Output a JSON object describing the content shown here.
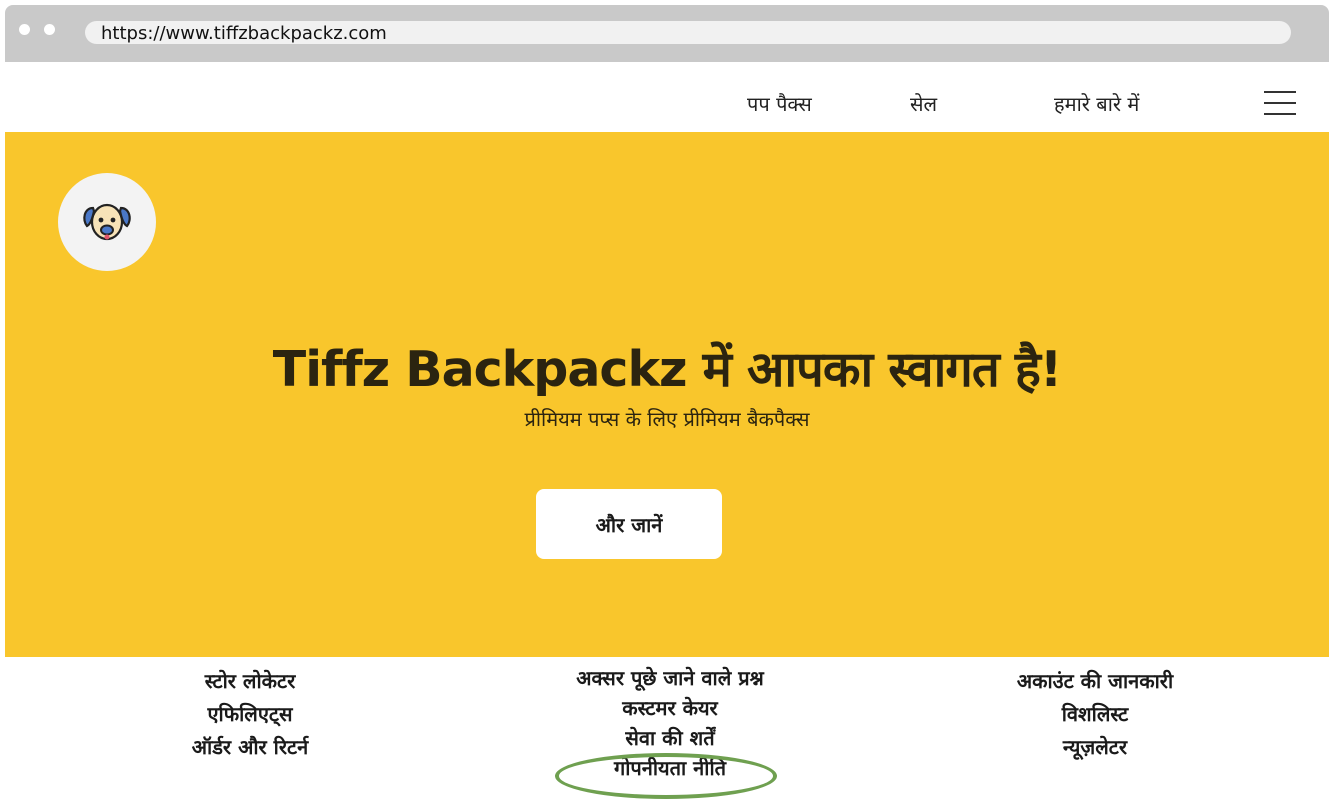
{
  "browser": {
    "url": "https://www.tiffzbackpackz.com"
  },
  "nav": {
    "items": [
      {
        "label": "पप पैक्स"
      },
      {
        "label": "सेल"
      },
      {
        "label": "हमारे बारे में"
      }
    ],
    "menu_icon": "hamburger-icon"
  },
  "hero": {
    "logo_icon": "dog-face-icon",
    "title": "Tiffz Backpackz में आपका स्वागत है!",
    "subtitle": "प्रीमियम पप्स के लिए प्रीमियम बैकपैक्स",
    "cta_label": "और जानें",
    "background_color": "#f9c62c"
  },
  "footer": {
    "columns": [
      {
        "links": [
          {
            "label": "स्टोर लोकेटर"
          },
          {
            "label": "एफिलिएट्स"
          },
          {
            "label": "ऑर्डर और रिटर्न"
          }
        ]
      },
      {
        "links": [
          {
            "label": "अक्सर पूछे जाने वाले प्रश्न"
          },
          {
            "label": "कस्टमर केयर"
          },
          {
            "label": "सेवा की शर्तें"
          },
          {
            "label": "गोपनीयता नीति"
          }
        ]
      },
      {
        "links": [
          {
            "label": "अकाउंट की जानकारी"
          },
          {
            "label": "विशलिस्ट"
          },
          {
            "label": "न्यूज़लेटर"
          }
        ]
      }
    ],
    "highlight_color": "#6fa050"
  }
}
